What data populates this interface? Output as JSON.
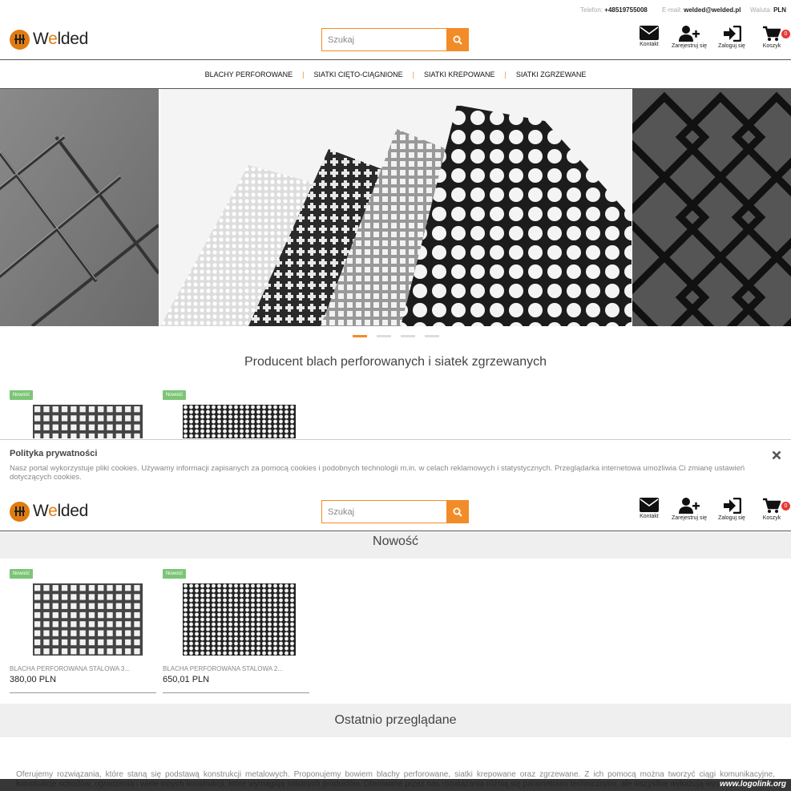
{
  "topbar": {
    "phone_label": "Telefon:",
    "phone": "+48519755008",
    "email_label": "E-mail:",
    "email": "welded@welded.pl",
    "currency_label": "Waluta:",
    "currency": "PLN"
  },
  "brand": {
    "name_pre": "W",
    "name_e": "e",
    "name_post": "lded"
  },
  "search": {
    "placeholder": "Szukaj"
  },
  "header_icons": {
    "contact": "Kontakt",
    "register": "Zarejestruj się",
    "login": "Zaloguj się",
    "cart": "Koszyk",
    "cart_count": "0"
  },
  "nav": [
    "BLACHY PERFOROWANE",
    "SIATKI CIĘTO-CIĄGNIONE",
    "SIATKI KREPOWANE",
    "SIATKI ZGRZEWANE"
  ],
  "tagline": "Producent blach perforowanych i siatek zgrzewanych",
  "new_badge": "Nowość",
  "privacy": {
    "title": "Polityka prywatności",
    "text": "Nasz portal wykorzystuje pliki cookies. Używamy informacji zapisanych za pomocą cookies i podobnych technologii m.in. w celach reklamowych i statystycznych. Przeglądarka internetowa umożliwia Ci zmianę ustawień dotyczących cookies."
  },
  "sections": {
    "new": "Nowość",
    "recent": "Ostatnio przeglądane"
  },
  "products": [
    {
      "name": "BLACHA PERFOROWANA STALOWA 3...",
      "price": "380,00 PLN"
    },
    {
      "name": "BLACHA PERFOROWANA STALOWA 2...",
      "price": "650,01 PLN"
    }
  ],
  "description": "Oferujemy rozwiązania, które staną się podstawą konstrukcji metalowych. Proponujemy bowiem blachy perforowane, siatki krepowane oraz zgrzewane. Z ich pomocą można tworzyć ciągi komunikacyjne, konstrukcje schodów, ogrodzenia i wiele innych konstrukcji, które wymagają solidnych produktów. Oferowane przez nas rozwiązania różnią się parametrami technicznymi, ale wszystkie wykazują wysoką",
  "watermark": "www.logolink.org"
}
